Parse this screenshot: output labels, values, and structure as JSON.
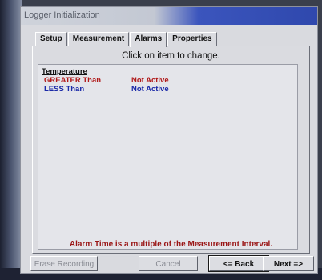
{
  "window": {
    "title": "Logger Initialization"
  },
  "tabs": [
    {
      "label": "Setup"
    },
    {
      "label": "Measurement"
    },
    {
      "label": "Alarms"
    },
    {
      "label": "Properties"
    }
  ],
  "panel": {
    "instruction": "Click on item to change.",
    "section_heading": "Temperature",
    "items": [
      {
        "condition": "GREATER Than",
        "status": "Not Active"
      },
      {
        "condition": "LESS Than",
        "status": "Not Active"
      }
    ],
    "footer_note": "Alarm Time is a multiple of the Measurement Interval."
  },
  "buttons": {
    "erase": "Erase Recording",
    "cancel": "Cancel",
    "back": "<= Back",
    "next": "Next =>"
  }
}
